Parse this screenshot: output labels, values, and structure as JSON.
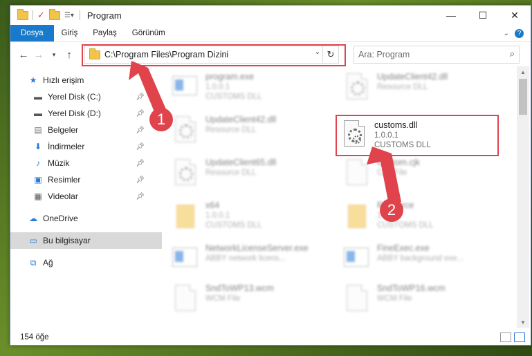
{
  "window": {
    "title": "Program",
    "minimize": "—",
    "maximize": "☐",
    "close": "✕"
  },
  "ribbon": {
    "tabs": [
      "Dosya",
      "Giriş",
      "Paylaş",
      "Görünüm"
    ],
    "help_icon": "?"
  },
  "nav": {
    "address": "C:\\Program Files\\Program Dizini",
    "search_placeholder": "Ara: Program"
  },
  "sidebar": {
    "quick_access": "Hızlı erişim",
    "items": [
      {
        "label": "Yerel Disk (C:)",
        "icon": "drive-icon"
      },
      {
        "label": "Yerel Disk (D:)",
        "icon": "drive-icon"
      },
      {
        "label": "Belgeler",
        "icon": "document-icon"
      },
      {
        "label": "İndirmeler",
        "icon": "download-icon"
      },
      {
        "label": "Müzik",
        "icon": "music-icon"
      },
      {
        "label": "Resimler",
        "icon": "pictures-icon"
      },
      {
        "label": "Videolar",
        "icon": "video-icon"
      }
    ],
    "onedrive": "OneDrive",
    "this_pc": "Bu bilgisayar",
    "network": "Ağ"
  },
  "files": [
    {
      "name": "program.exe",
      "line1": "1.0.0.1",
      "line2": "CUSTOMS DLL",
      "type": "exe"
    },
    {
      "name": "UpdateClient42.dll",
      "line1": "Resource DLL",
      "line2": "",
      "type": "dll"
    },
    {
      "name": "UpdateClient42.dll",
      "line1": "Resource DLL",
      "line2": "",
      "type": "dll"
    },
    {
      "name": "customs.dll",
      "line1": "1.0.0.1",
      "line2": "CUSTOMS DLL",
      "type": "dll"
    },
    {
      "name": "UpdateClient65.dll",
      "line1": "Resource DLL",
      "line2": "",
      "type": "dll"
    },
    {
      "name": "Custom.cjk",
      "line1": "CJK File",
      "line2": "",
      "type": "doc"
    },
    {
      "name": "x64",
      "line1": "1.0.0.1",
      "line2": "CUSTOMS DLL",
      "type": "folder"
    },
    {
      "name": "Resource",
      "line1": "1.0.0.1",
      "line2": "CUSTOMS DLL",
      "type": "folder"
    },
    {
      "name": "NetworkLicenseServer.exe",
      "line1": "ABBY network licens...",
      "line2": "",
      "type": "exe"
    },
    {
      "name": "FineExec.exe",
      "line1": "ABBY background exe...",
      "line2": "",
      "type": "exe"
    },
    {
      "name": "SndToWP13.wcm",
      "line1": "WCM File",
      "line2": "",
      "type": "doc"
    },
    {
      "name": "SndToWP16.wcm",
      "line1": "WCM File",
      "line2": "",
      "type": "doc"
    }
  ],
  "status": {
    "count": "154 öğe"
  },
  "annotations": {
    "step1": "1",
    "step2": "2"
  },
  "colors": {
    "accent": "#1979ca",
    "highlight": "#e0434b"
  }
}
